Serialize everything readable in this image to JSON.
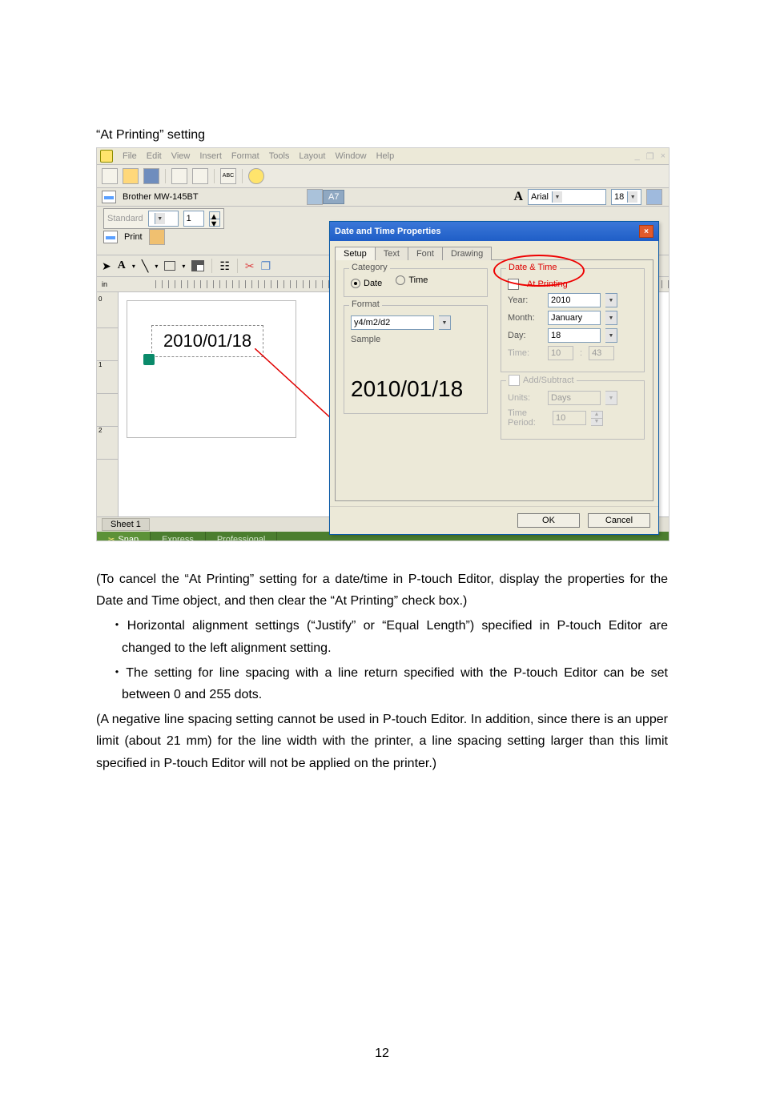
{
  "doc": {
    "section_title": "“At Printing” setting",
    "p1": "(To cancel the “At Printing” setting for a date/time in P-touch Editor, display the properties for the Date and Time object, and then clear the “At Printing” check box.)",
    "p2": "・Horizontal alignment settings (“Justify” or “Equal Length”) specified in P-touch Editor are changed to the left alignment setting.",
    "p3": "・The setting for line spacing with a line return specified with the P-touch Editor can be set between 0 and 255 dots.",
    "p4": "(A negative line spacing setting cannot be used in P-touch Editor. In addition, since there is an upper limit (about 21 mm) for the line width with the printer, a line spacing setting larger than this limit specified in P-touch Editor will not be applied on the printer.)",
    "page_number": "12"
  },
  "menu": {
    "file": "File",
    "edit": "Edit",
    "view": "View",
    "insert": "Insert",
    "format": "Format",
    "tools": "Tools",
    "layout": "Layout",
    "window": "Window",
    "help": "Help"
  },
  "paperbar": {
    "printer": "Brother MW-145BT",
    "size": "A7",
    "font": "Arial",
    "fontsize": "18"
  },
  "page_panel": {
    "standard": "Standard",
    "copies": "1",
    "print": "Print"
  },
  "ruler_unit": "in",
  "canvas": {
    "date_text": "2010/01/18"
  },
  "sheet_tab": "Sheet 1",
  "modes": {
    "snap": "Snap",
    "express": "Express",
    "pro": "Professional"
  },
  "dialog": {
    "title": "Date and Time Properties",
    "tabs": {
      "setup": "Setup",
      "text": "Text",
      "font": "Font",
      "drawing": "Drawing"
    },
    "category_legend": "Category",
    "radio_date": "Date",
    "radio_time": "Time",
    "format_legend": "Format",
    "format_value": "y4/m2/d2",
    "sample_label": "Sample",
    "sample_value": "2010/01/18",
    "datetime_legend": "Date & Time",
    "at_printing": "At Printing",
    "year_l": "Year:",
    "year_v": "2010",
    "month_l": "Month:",
    "month_v": "January",
    "day_l": "Day:",
    "day_v": "18",
    "time_l": "Time:",
    "time_h": "10",
    "time_m": "43",
    "addsub_legend": "Add/Subtract",
    "units_l": "Units:",
    "units_v": "Days",
    "period_l": "Time Period:",
    "period_v": "10",
    "ok": "OK",
    "cancel": "Cancel"
  }
}
